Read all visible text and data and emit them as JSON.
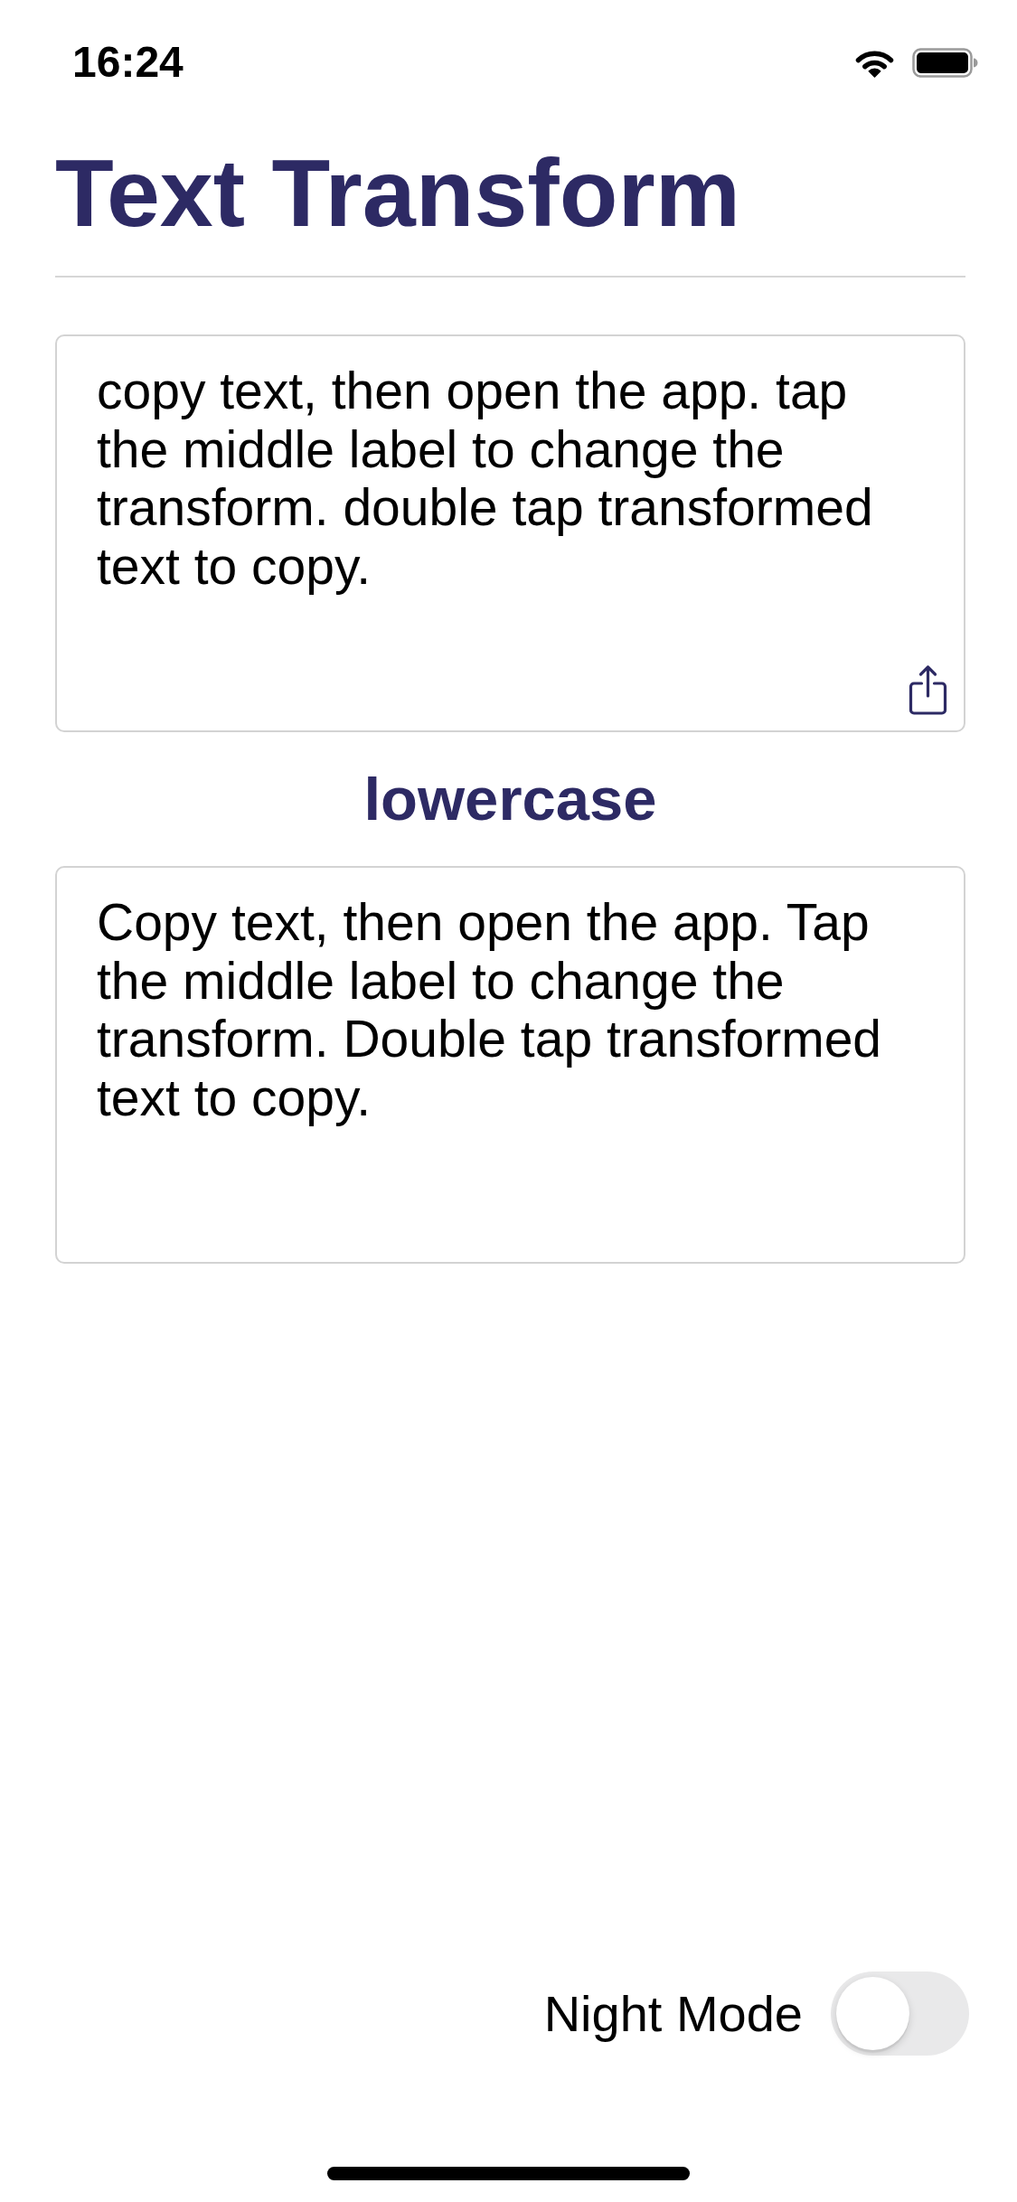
{
  "status_bar": {
    "time": "16:24"
  },
  "title": "Text Transform",
  "top_text_area": {
    "text": "copy text, then open the app. tap the middle label to change the transform. double tap transformed text to copy."
  },
  "transform_label": "lowercase",
  "bottom_text_area": {
    "text": "Copy text, then open the app. Tap the middle label to change the transform. Double tap transformed text to copy."
  },
  "night_mode": {
    "label": "Night Mode",
    "on": false
  }
}
